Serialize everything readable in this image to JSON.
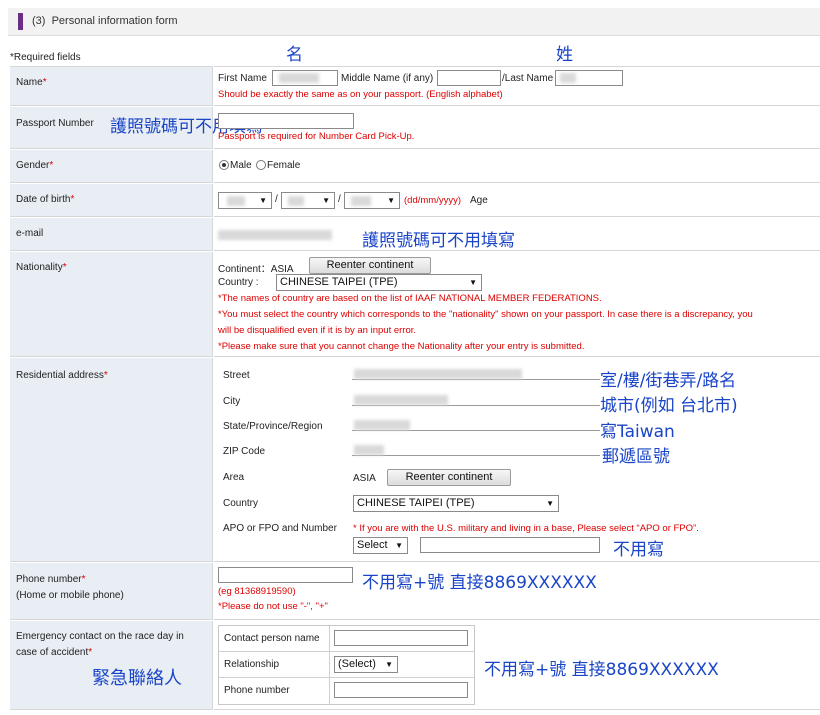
{
  "section": {
    "number": "(3)",
    "title": "Personal information form"
  },
  "required_note": "*Required fields",
  "annotations": {
    "given_name": "名",
    "surname": "姓",
    "passport_optional": "護照號碼可不用填寫",
    "email_note": "護照號碼可不用填寫",
    "street_note": "室/樓/街巷弄/路名",
    "city_note": "城市(例如 台北市)",
    "state_note": "寫Taiwan",
    "zip_note": "郵遞區號",
    "apo_note": "不用寫",
    "phone_note": "不用寫+號 直接8869XXXXXX",
    "emergency_label_note": "緊急聯絡人",
    "emergency_phone_note": "不用寫+號 直接8869XXXXXX"
  },
  "name": {
    "label": "Name",
    "first_label": "First Name",
    "middle_label": "Middle Name (if any)",
    "last_label": "/Last Name",
    "hint": "Should be exactly the same as on your passport. (English alphabet)"
  },
  "passport": {
    "label": "Passport Number",
    "hint": "Passport is required for Number Card Pick-Up."
  },
  "gender": {
    "label": "Gender",
    "male": "Male",
    "female": "Female",
    "selected": "Male"
  },
  "dob": {
    "label": "Date of birth",
    "format": "(dd/mm/yyyy)",
    "age_label": "Age",
    "sep": "/"
  },
  "email": {
    "label": "e-mail"
  },
  "nationality": {
    "label": "Nationality",
    "continent_label": "Continent：ASIA",
    "reenter": "Reenter continent",
    "country_label": "Country  :",
    "country_value": "CHINESE TAIPEI (TPE)",
    "note1": "*The names of country are based on the list of IAAF NATIONAL MEMBER FEDERATIONS.",
    "note2": "*You must select the country which corresponds to the \"nationality\" shown on your passport. In case there is a discrepancy, you",
    "note3": "will be disqualified even if it is by an input error.",
    "note4": "*Please make sure that you cannot change the Nationality after your entry is submitted."
  },
  "address": {
    "label": "Residential address",
    "street": "Street",
    "city": "City",
    "state": "State/Province/Region",
    "zip": "ZIP Code",
    "area": "Area",
    "area_value": "ASIA",
    "reenter": "Reenter continent",
    "country": "Country",
    "country_value": "CHINESE TAIPEI (TPE)",
    "apo": "APO or FPO and Number",
    "apo_hint": "* If you are with the U.S. military and living in a base, Please select “APO or FPO”.",
    "apo_select": "Select"
  },
  "phone": {
    "label": "Phone number",
    "sub": "(Home or mobile phone)",
    "example": "(eg 81368919590)",
    "hint": "*Please do not use \"-\", \"+\""
  },
  "emergency": {
    "label_line1": "Emergency contact on the race day in",
    "label_line2": "case of accident",
    "contact_name": "Contact person name",
    "relationship": "Relationship",
    "relationship_select": "(Select)",
    "phone": "Phone number"
  },
  "colors": {
    "accent": "#6a2e86",
    "label_bg": "#e8eef4",
    "required": "#dd0000",
    "annotation": "#1a45c8"
  }
}
